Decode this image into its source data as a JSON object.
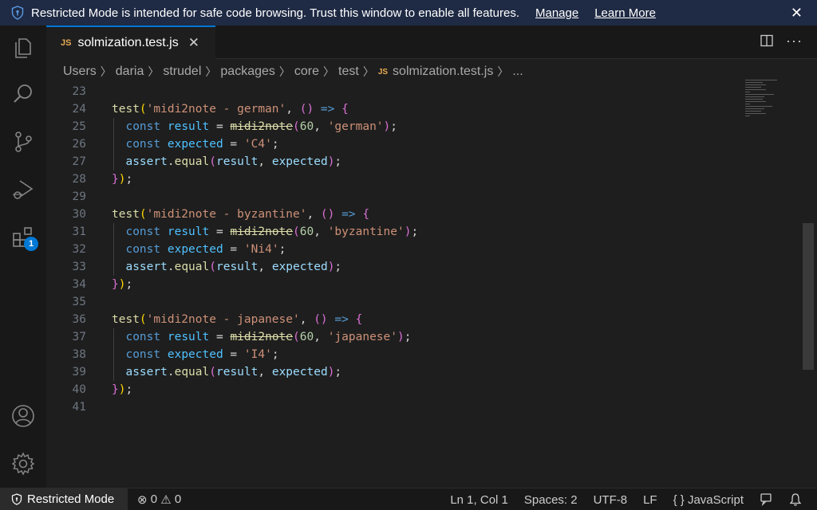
{
  "banner": {
    "message": "Restricted Mode is intended for safe code browsing. Trust this window to enable all features.",
    "manage_label": "Manage",
    "learn_more_label": "Learn More",
    "close_icon": "close-icon"
  },
  "activity_bar": {
    "items": [
      {
        "name": "explorer",
        "icon": "files-icon"
      },
      {
        "name": "search",
        "icon": "search-icon"
      },
      {
        "name": "source-control",
        "icon": "source-control-icon"
      },
      {
        "name": "run-debug",
        "icon": "run-debug-icon"
      },
      {
        "name": "extensions",
        "icon": "extensions-icon",
        "badge": "1"
      }
    ],
    "bottom": [
      {
        "name": "accounts",
        "icon": "account-icon"
      },
      {
        "name": "manage",
        "icon": "gear-icon"
      }
    ]
  },
  "tab": {
    "lang_badge": "JS",
    "filename": "solmization.test.js",
    "close_glyph": "✕"
  },
  "breadcrumb": {
    "items": [
      "Users",
      "daria",
      "strudel",
      "packages",
      "core",
      "test"
    ],
    "file_badge": "JS",
    "file": "solmization.test.js",
    "ellipsis": "..."
  },
  "editor": {
    "line_numbers": [
      "23",
      "24",
      "25",
      "26",
      "27",
      "28",
      "29",
      "30",
      "31",
      "32",
      "33",
      "34",
      "35",
      "36",
      "37",
      "38",
      "39",
      "40",
      "41"
    ],
    "tests": [
      {
        "name": "'midi2note - german'",
        "lang": "'german'",
        "expected": "'C4'"
      },
      {
        "name": "'midi2note - byzantine'",
        "lang": "'byzantine'",
        "expected": "'Ni4'"
      },
      {
        "name": "'midi2note - japanese'",
        "lang": "'japanese'",
        "expected": "'I4'"
      }
    ],
    "tokens": {
      "test": "test",
      "arrow": "() =>",
      "const": "const",
      "result": "result",
      "expected": "expected",
      "midi2note": "midi2note",
      "num": "60",
      "assert": "assert",
      "equal": "equal"
    }
  },
  "status_bar": {
    "restricted_label": "Restricted Mode",
    "errors": "0",
    "warnings": "0",
    "position": "Ln 1, Col 1",
    "spaces": "Spaces: 2",
    "encoding": "UTF-8",
    "eol": "LF",
    "language": "JavaScript",
    "language_glyph": "{ }"
  },
  "colors": {
    "accent": "#0078d4",
    "banner_bg": "#1f2a44",
    "js_badge": "#e8ab53"
  }
}
